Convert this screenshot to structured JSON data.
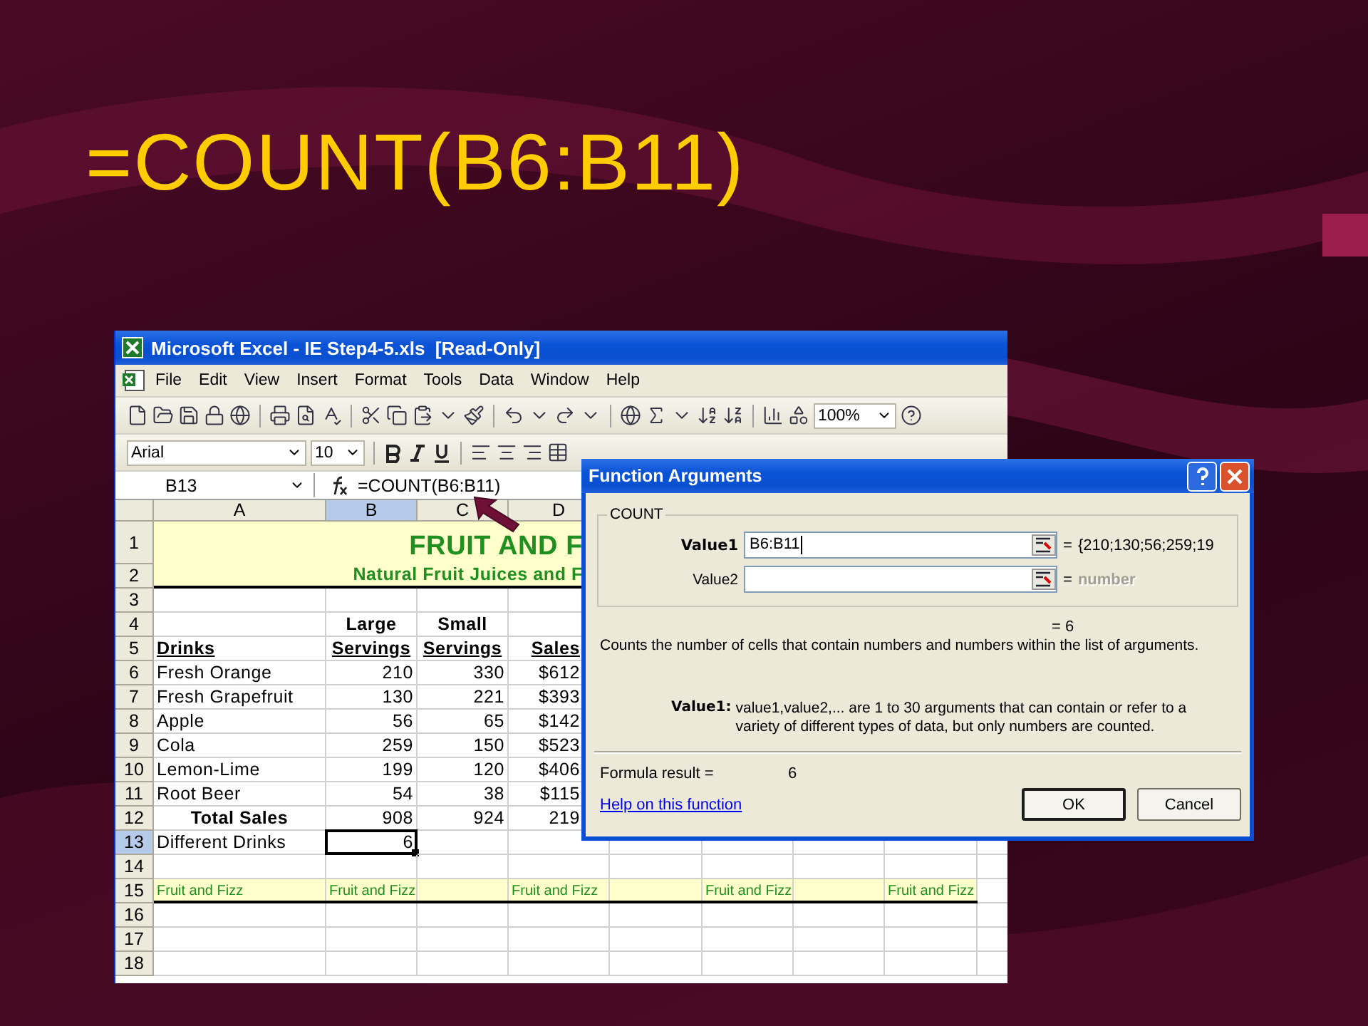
{
  "slide": {
    "title": "=COUNT(B6:B11)"
  },
  "excel": {
    "title": "Microsoft Excel - IE Step4-5.xls  [Read-Only]",
    "menu": [
      "File",
      "Edit",
      "View",
      "Insert",
      "Format",
      "Tools",
      "Data",
      "Window",
      "Help"
    ],
    "toolbar": {
      "zoom": "100%",
      "font": "Arial",
      "font_size": "10"
    },
    "name_box": "B13",
    "formula": "=COUNT(B6:B11)",
    "columns": [
      {
        "label": "A",
        "selected": false
      },
      {
        "label": "B",
        "selected": true
      },
      {
        "label": "C",
        "selected": false
      },
      {
        "label": "D",
        "selected": false
      }
    ],
    "rows": [
      {
        "label": "1",
        "selected": false,
        "kind": "title",
        "banner": "FRUIT AND F"
      },
      {
        "label": "2",
        "selected": false,
        "kind": "subtitle",
        "banner": "Natural Fruit Juices and F"
      },
      {
        "label": "3",
        "selected": false,
        "kind": "data"
      },
      {
        "label": "4",
        "selected": false,
        "kind": "heading",
        "underlined": false,
        "b": "Large",
        "c": "Small"
      },
      {
        "label": "5",
        "selected": false,
        "kind": "heading",
        "underlined": true,
        "a": "Drinks",
        "b": "Servings",
        "c": "Servings",
        "d": "Sales"
      },
      {
        "label": "6",
        "selected": false,
        "kind": "data",
        "a": "Fresh Orange",
        "b": "210",
        "c": "330",
        "d": "$612"
      },
      {
        "label": "7",
        "selected": false,
        "kind": "data",
        "a": "Fresh Grapefruit",
        "b": "130",
        "c": "221",
        "d": "$393"
      },
      {
        "label": "8",
        "selected": false,
        "kind": "data",
        "a": "Apple",
        "b": "56",
        "c": "65",
        "d": "$142"
      },
      {
        "label": "9",
        "selected": false,
        "kind": "data",
        "a": "Cola",
        "b": "259",
        "c": "150",
        "d": "$523"
      },
      {
        "label": "10",
        "selected": false,
        "kind": "data",
        "a": "Lemon-Lime",
        "b": "199",
        "c": "120",
        "d": "$406"
      },
      {
        "label": "11",
        "selected": false,
        "kind": "data",
        "a": "Root Beer",
        "b": "54",
        "c": "38",
        "d": "$115"
      },
      {
        "label": "12",
        "selected": false,
        "kind": "total",
        "a": "Total Sales",
        "b": "908",
        "c": "924",
        "d": "219"
      },
      {
        "label": "13",
        "selected": true,
        "kind": "data",
        "a": "Different Drinks",
        "b": "6"
      },
      {
        "label": "14",
        "selected": false,
        "kind": "data"
      },
      {
        "label": "15",
        "selected": false,
        "kind": "footer",
        "a": "Fruit and Fizz",
        "b": "Fruit and Fizz",
        "d": "Fruit and Fizz",
        "f": "Fruit and Fizz",
        "h": "Fruit and Fizz"
      },
      {
        "label": "16",
        "selected": false,
        "kind": "data"
      },
      {
        "label": "17",
        "selected": false,
        "kind": "data"
      },
      {
        "label": "18",
        "selected": false,
        "kind": "data"
      }
    ]
  },
  "dialog": {
    "title": "Function Arguments",
    "group": "COUNT",
    "arguments": [
      {
        "label": "Value1",
        "selected": true,
        "value": "B6:B11",
        "equals": "=",
        "result": "{210;130;56;259;19",
        "dim": false
      },
      {
        "label": "Value2",
        "selected": false,
        "equals": "=",
        "result": "number",
        "dim": true
      }
    ],
    "result": "= 6",
    "description": "Counts the number of cells that contain numbers and numbers within the list of arguments.",
    "argument_label": "Value1:",
    "argument_help": "value1,value2,... are 1 to 30 arguments that can contain or refer to a variety of different types of data, but only numbers are counted.",
    "formula_result_label": "Formula result =",
    "formula_result": "6",
    "help_link": "Help on this function",
    "buttons": [
      {
        "label": "OK",
        "default": true
      },
      {
        "label": "Cancel",
        "default": false
      }
    ]
  }
}
